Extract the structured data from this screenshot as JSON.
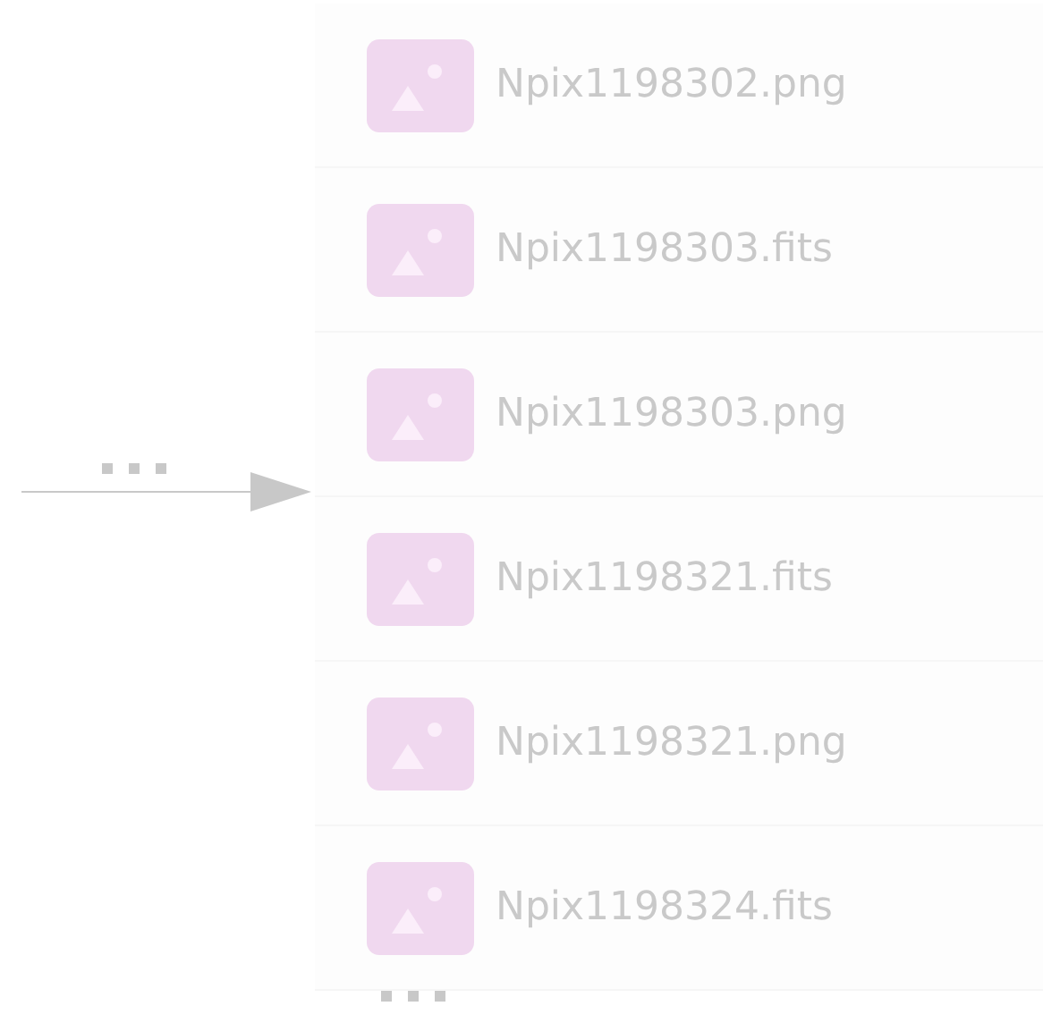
{
  "files": [
    {
      "name": "Npix1198302.png"
    },
    {
      "name": "Npix1198303.fits"
    },
    {
      "name": "Npix1198303.png"
    },
    {
      "name": "Npix1198321.fits"
    },
    {
      "name": "Npix1198321.png"
    },
    {
      "name": "Npix1198324.fits"
    }
  ]
}
